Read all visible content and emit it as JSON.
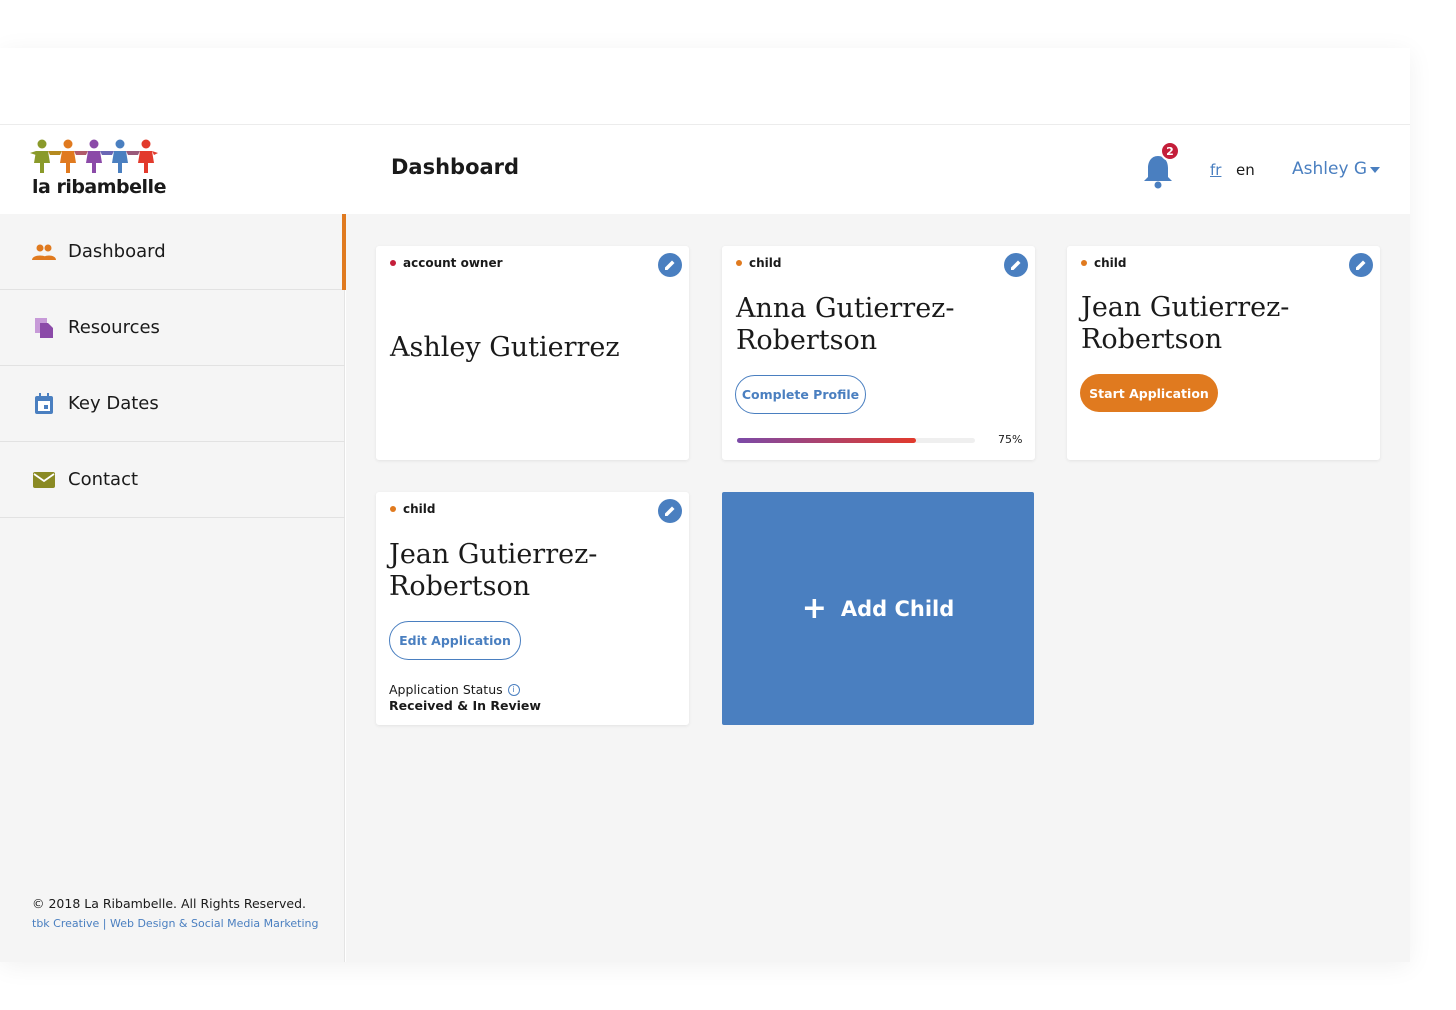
{
  "brand": {
    "name": "la ribambelle"
  },
  "sidebar": {
    "items": [
      {
        "label": "Dashboard",
        "icon": "people-icon",
        "color": "#e07a1f",
        "active": true
      },
      {
        "label": "Resources",
        "icon": "document-icon",
        "color": "#8b4aa8",
        "active": false
      },
      {
        "label": "Key Dates",
        "icon": "calendar-icon",
        "color": "#4a7fc0",
        "active": false
      },
      {
        "label": "Contact",
        "icon": "mail-icon",
        "color": "#8a8a24",
        "active": false
      }
    ],
    "footer": {
      "copyright": "© 2018 La Ribambelle. All Rights Reserved.",
      "credit": "tbk Creative | Web Design & Social Media Marketing"
    }
  },
  "header": {
    "title": "Dashboard",
    "notifications": "2",
    "lang_fr": "fr",
    "lang_en": "en",
    "user": "Ashley G"
  },
  "cards": [
    {
      "tag": "account owner",
      "tag_color": "#c41e3a",
      "name": "Ashley Gutierrez"
    },
    {
      "tag": "child",
      "tag_color": "#e07a1f",
      "name": "Anna Gutierrez-Robertson",
      "button": "Complete Profile",
      "progress": 75,
      "progress_label": "75%"
    },
    {
      "tag": "child",
      "tag_color": "#e07a1f",
      "name": "Jean Gutierrez-Robertson",
      "button": "Start Application"
    },
    {
      "tag": "child",
      "tag_color": "#e07a1f",
      "name": "Jean Gutierrez-Robertson",
      "button": "Edit Application",
      "status_label": "Application Status",
      "status_value": "Received & In Review"
    }
  ],
  "add_child": {
    "label": "Add Child"
  },
  "colors": {
    "accent": "#4a7fc0",
    "orange": "#e07a1f",
    "badge": "#c41e3a"
  }
}
